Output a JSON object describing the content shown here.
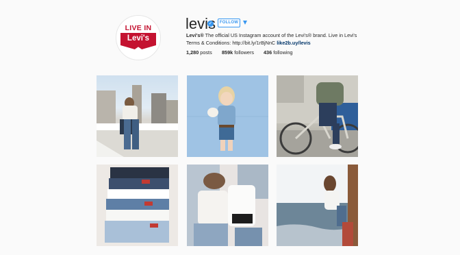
{
  "profile": {
    "username": "levis",
    "follow_label": "FOLLOW",
    "avatar_text_top": "LIVE IN",
    "avatar_text_brand": "Levi's",
    "bio_name": "Levi's®",
    "bio_text": " The official US Instagram account of the Levi's® brand. Live in Levi's Terms & Conditions: http://bit.ly/1rBjNnC ",
    "bio_link": "like2b.uy/levis"
  },
  "stats": {
    "posts_count": "1,280",
    "posts_label": "posts",
    "followers_count": "859k",
    "followers_label": "followers",
    "following_count": "436",
    "following_label": "following"
  },
  "posts": [
    {
      "name": "post-rooftop-woman"
    },
    {
      "name": "post-toddler-blue-wall"
    },
    {
      "name": "post-cyclist"
    },
    {
      "name": "post-denim-shorts-stack"
    },
    {
      "name": "post-couple-lying"
    },
    {
      "name": "post-woman-seaside"
    }
  ],
  "colors": {
    "brand_red": "#c41230",
    "accent_blue": "#3897f0",
    "link_blue": "#003569"
  }
}
